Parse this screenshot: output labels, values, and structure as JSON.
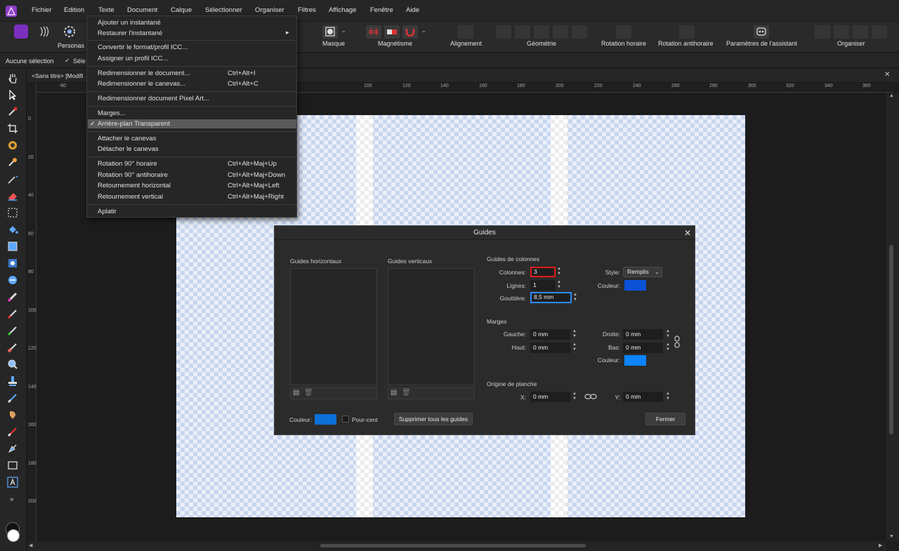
{
  "menubar": {
    "items": [
      "Fichier",
      "Edition",
      "Texte",
      "Document",
      "Calque",
      "Sélectionner",
      "Organiser",
      "Filtres",
      "Affichage",
      "Fenêtre",
      "Aide"
    ]
  },
  "toolbar": {
    "personas_label": "Personas",
    "masque_label": "Masque",
    "magnetisme_label": "Magnétisme",
    "alignement_label": "Alignement",
    "geometrie_label": "Géométrie",
    "rotation_horaire_label": "Rotation horaire",
    "rotation_antihoraire_label": "Rotation antihoraire",
    "assistant_label": "Paramètres de l'assistant",
    "organiser_label": "Organiser"
  },
  "contextbar": {
    "selection_text": "Aucune sélection",
    "option_label": "Séle"
  },
  "document": {
    "tab_title": "<Sans titre> [Modifi"
  },
  "ruler": {
    "h_ticks": [
      "-60",
      "100",
      "120",
      "140",
      "160",
      "180",
      "200",
      "220",
      "240",
      "260",
      "280",
      "300",
      "320",
      "340",
      "360"
    ],
    "v_ticks": [
      "0",
      "20",
      "40",
      "60",
      "80",
      "100",
      "120",
      "140",
      "160",
      "180",
      "200"
    ]
  },
  "dropdown": {
    "items": [
      {
        "label": "Ajouter un instantané",
        "shortcut": ""
      },
      {
        "label": "Restaurer l'instantané",
        "shortcut": ""
      },
      {
        "label": "Convertir le format/profil ICC...",
        "shortcut": ""
      },
      {
        "label": "Assigner un profil ICC...",
        "shortcut": ""
      },
      {
        "label": "Redimensionner le document...",
        "shortcut": "Ctrl+Alt+I"
      },
      {
        "label": "Redimensionner le canevas...",
        "shortcut": "Ctrl+Alt+C"
      },
      {
        "label": "Redimensionner document Pixel Art...",
        "shortcut": ""
      },
      {
        "label": "Marges...",
        "shortcut": ""
      },
      {
        "label": "Arrière-plan Transparent",
        "shortcut": ""
      },
      {
        "label": "Attacher le canevas",
        "shortcut": ""
      },
      {
        "label": "Détacher le canevas",
        "shortcut": ""
      },
      {
        "label": "Rotation 90° horaire",
        "shortcut": "Ctrl+Alt+Maj+Up"
      },
      {
        "label": "Rotation 90° antihoraire",
        "shortcut": "Ctrl+Alt+Maj+Down"
      },
      {
        "label": "Retournement horizontal",
        "shortcut": "Ctrl+Alt+Maj+Left"
      },
      {
        "label": "Retournement vertical",
        "shortcut": "Ctrl+Alt+Maj+Right"
      },
      {
        "label": "Aplatir",
        "shortcut": ""
      }
    ],
    "check_mark": "✓",
    "submenu_arrow": "▸"
  },
  "dialog": {
    "title": "Guides",
    "close": "✕",
    "horizontal_guides_label": "Guides horizontaux",
    "vertical_guides_label": "Guides verticaux",
    "column_guides_label": "Guides de colonnes",
    "colonnes_label": "Colonnes:",
    "colonnes_value": "3",
    "lignes_label": "Lignes:",
    "lignes_value": "1",
    "gouttiere_label": "Gouttière:",
    "gouttiere_value": "8,5 mm",
    "style_label": "Style:",
    "style_value": "Remplis",
    "couleur_label": "Couleur:",
    "column_color": "#0b52d8",
    "marges_label": "Marges",
    "gauche_label": "Gauche:",
    "gauche_value": "0 mm",
    "haut_label": "Haut:",
    "haut_value": "0 mm",
    "droite_label": "Droite:",
    "droite_value": "0 mm",
    "bas_label": "Bas:",
    "bas_value": "0 mm",
    "margin_color": "#0a84ff",
    "origine_label": "Origine de planche",
    "x_label": "X:",
    "x_value": "0 mm",
    "y_label": "Y:",
    "y_value": "0 mm",
    "bottom_couleur_label": "Couleur:",
    "guide_color": "#0b6fd6",
    "pourcent_label": "Pour-cent",
    "delete_all_label": "Supprimer tous les guides",
    "close_label": "Fermer"
  }
}
